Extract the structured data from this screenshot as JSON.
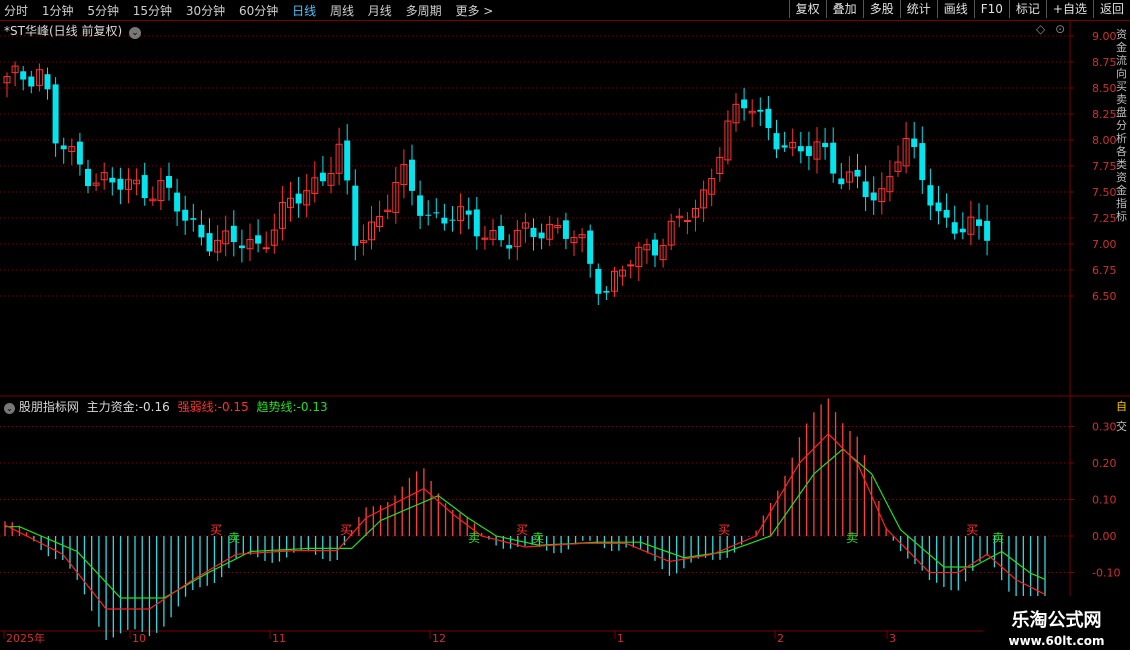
{
  "toolbar": {
    "periods": [
      "分时",
      "1分钟",
      "5分钟",
      "15分钟",
      "30分钟",
      "60分钟",
      "日线",
      "周线",
      "月线",
      "多周期",
      "更多 >"
    ],
    "active_period": "日线",
    "right_buttons": [
      "复权",
      "叠加",
      "多股",
      "统计",
      "画线",
      "F10",
      "标记",
      "+自选",
      "返回"
    ]
  },
  "main_panel": {
    "title": "*ST华峰(日线 前复权)",
    "price_ticks": [
      "9.00",
      "8.75",
      "8.50",
      "8.25",
      "8.00",
      "7.75",
      "7.50",
      "7.25",
      "7.00",
      "6.75",
      "6.50"
    ]
  },
  "indicator_panel": {
    "name": "股朋指标网",
    "main_force_label": "主力资金:",
    "main_force_value": "-0.16",
    "strength_label": "强弱线:",
    "strength_value": "-0.15",
    "trend_label": "趋势线:",
    "trend_value": "-0.13",
    "y_ticks": [
      "0.30",
      "0.20",
      "0.10",
      "0.00",
      "-0.10"
    ],
    "signals": [
      "买",
      "卖",
      "买",
      "卖",
      "买",
      "卖",
      "买",
      "卖",
      "买",
      "卖"
    ]
  },
  "date_axis": [
    "2025年",
    "10",
    "11",
    "12",
    "1",
    "2",
    "3"
  ],
  "sidebar": {
    "text": "资金流向买卖盘分析各类资金指标",
    "marker_1": "自",
    "marker_2": "交"
  },
  "watermark": {
    "line1": "乐淘公式网",
    "line2": "www.60lt.com"
  },
  "colors": {
    "up": "#ff3232",
    "down": "#00e5ee",
    "red_line": "#ff2020",
    "green_line": "#22dd22",
    "grid": "#7a0000"
  }
}
